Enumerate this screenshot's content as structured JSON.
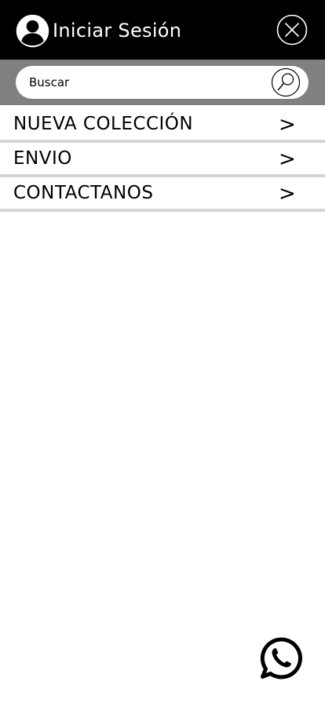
{
  "header": {
    "login_label": "Iniciar Sesión",
    "icons": {
      "avatar": "user-avatar-icon",
      "close": "close-icon"
    }
  },
  "search": {
    "placeholder": "Buscar",
    "value": "",
    "icon": "magnifier-icon"
  },
  "menu": {
    "items": [
      {
        "label": "NUEVA COLECCIÓN",
        "arrow": ">"
      },
      {
        "label": "ENVIO",
        "arrow": ">"
      },
      {
        "label": "CONTACTANOS",
        "arrow": ">"
      }
    ]
  },
  "floating": {
    "icon": "whatsapp-icon"
  },
  "colors": {
    "header_bg": "#000000",
    "search_band_bg": "#808080",
    "divider": "#d4d4d4",
    "text": "#000000",
    "header_text": "#ffffff"
  }
}
